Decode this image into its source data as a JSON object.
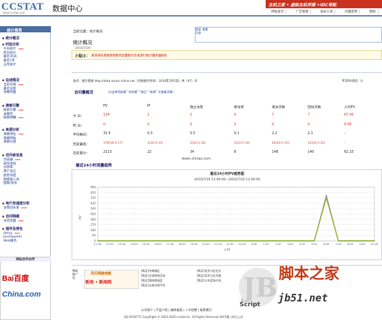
{
  "header": {
    "logo": "CCSTAT",
    "logo_url": "www.ccstat.com",
    "logo_cn": "数据中心",
    "ad_text": "主机之家 • 虚拟主机评测 +IDC导航",
    "links": [
      "网站首页",
      "广告管理",
      "站长工具",
      "问题反馈",
      "帮助"
    ]
  },
  "sidebar": {
    "title": "统计报表",
    "sections": [
      {
        "label": "统计概况",
        "top": 52,
        "items": []
      },
      {
        "label": "时段分析",
        "top": 61,
        "items": [
          {
            "label": "今日统计",
            "new": true
          },
          {
            "label": "昨日统计",
            "new": false
          },
          {
            "label": "最近30天",
            "new": false
          },
          {
            "label": "最近1年",
            "new": false
          },
          {
            "label": "五年统计",
            "new": false
          }
        ]
      },
      {
        "label": "在线情况",
        "top": 113,
        "items": [
          {
            "label": "当前在线",
            "new": true
          },
          {
            "label": "最近访客",
            "new": false
          },
          {
            "label": "详细页面",
            "new": false
          }
        ]
      },
      {
        "label": "搜索引擎",
        "top": 150,
        "items": [
          {
            "label": "搜索引擎",
            "new": true
          },
          {
            "label": "关键字",
            "new": false
          },
          {
            "label": "搜索明细",
            "new": true
          }
        ]
      },
      {
        "label": "来源分析",
        "top": 185,
        "items": [
          {
            "label": "来路地址",
            "new": true
          },
          {
            "label": "来路网站",
            "new": false
          },
          {
            "label": "来路分类",
            "new": false
          }
        ]
      },
      {
        "label": "访问者信息",
        "top": 222,
        "items": [
          {
            "label": "浏览器",
            "new": true
          },
          {
            "label": "操作系统",
            "new": false
          },
          {
            "label": "分辨率",
            "new": false
          },
          {
            "label": "用户语言",
            "new": false
          },
          {
            "label": "颜色深度",
            "new": false
          },
          {
            "label": "网络接入商",
            "new": false
          },
          {
            "label": "国家/省份",
            "new": false
          }
        ]
      },
      {
        "label": "用户忠诚度分析",
        "top": 292,
        "items": [
          {
            "label": "访客回头率",
            "new": true
          }
        ]
      },
      {
        "label": "访问明细",
        "top": 311,
        "items": [
          {
            "label": "访问页面",
            "new": true
          }
        ]
      },
      {
        "label": "插件及排名",
        "top": 329,
        "items": [
          {
            "label": "Alexa",
            "new": true
          },
          {
            "label": "JavaApplets",
            "new": false
          },
          {
            "label": "Web服务",
            "new": false
          }
        ]
      }
    ]
  },
  "friends": {
    "title": "网站合作伙伴",
    "baidu": "Bai百度",
    "china": "China.com"
  },
  "main": {
    "crumb": "当前位置：统计概况",
    "title": "统计概况",
    "date": "（2010/7/20）",
    "login_label": "登录记录",
    "login_link": "查看",
    "tip_label": "小贴士：",
    "tip_text": "即日排名系统改用新的流量统计方式进行统计服务器排名",
    "site_line": "站点：统计系统    http://data.music-china.net（开始统计时间：2010年5月5日）共（97）天",
    "yesterday_pv": "昨日PV排名：0",
    "overview_title": "访问量概况",
    "overview_links": "（点击单项标题 \"浏览量\" \"独立\" \"来源\" 可查看详情）",
    "domain_mark": "down.chinaz.com"
  },
  "table": {
    "headers": [
      "PV",
      "IP",
      "独立访客",
      "新访客",
      "来访次数",
      "回访次数",
      "人均PV"
    ],
    "rows": [
      {
        "label": "今  日：",
        "cells": [
          "134",
          "1",
          "2",
          "0",
          "7",
          "7",
          "67.00"
        ],
        "red": true
      },
      {
        "label": "昨  日：",
        "cells": [
          "0",
          "0",
          "0",
          "0",
          "0",
          "0",
          "0.00"
        ],
        "red": true
      },
      {
        "label": "平均每日：",
        "cells": [
          "31.5",
          "0.3",
          "0.5",
          "0.1",
          "2.2",
          "2.1",
          "-"
        ],
        "red": false
      },
      {
        "label": "历史最高：",
        "cells": [
          "379(10-5-17)",
          "1(10-5-15)",
          "5(10-5-10)",
          "5(10-5-10)",
          "40(10-5-15)",
          "31(10-5-15)",
          "-"
        ],
        "red": false
      },
      {
        "label": "历史累计：",
        "cells": [
          "2113",
          "22",
          "34",
          "8",
          "148",
          "140",
          "62.15"
        ],
        "red": false
      }
    ]
  },
  "chart_section_title": "最近24小时流量趋势",
  "chart_data": {
    "type": "line",
    "title": "最近24小时PV趋势图",
    "subtitle": "2010/7/19 11:00:00—2010/7/20 12:00:00",
    "ylabel": "PV",
    "xlabel": "小时",
    "yticks": [
      "0",
      "90",
      "180",
      "270",
      "360",
      "450",
      "540",
      "630",
      "720",
      "810",
      "900"
    ],
    "ylim": [
      0,
      900
    ],
    "categories": [
      "11:00",
      "12:00",
      "13:00",
      "14:00",
      "15:00",
      "16:00",
      "17:00",
      "18:00",
      "19:00",
      "20:00",
      "21:00",
      "22:00",
      "23:00",
      "0:00",
      "1:00",
      "2:00",
      "3:00",
      "4:00",
      "5:00",
      "6:00",
      "7:00",
      "8:00",
      "9:00",
      "10:00"
    ],
    "series": [
      {
        "name": "",
        "color": "#9b59b6",
        "values": [
          0,
          0,
          0,
          0,
          0,
          0,
          0,
          0,
          0,
          0,
          0,
          0,
          0,
          0,
          0,
          0,
          0,
          0,
          0,
          750,
          0,
          0,
          0,
          0
        ]
      },
      {
        "name": "",
        "color": "#8cbf26",
        "values": [
          0,
          0,
          0,
          0,
          0,
          0,
          0,
          0,
          0,
          0,
          0,
          0,
          0,
          0,
          0,
          0,
          0,
          0,
          0,
          720,
          0,
          0,
          0,
          0
        ]
      }
    ]
  },
  "ads": {
    "label": "赞助商广告",
    "ad1_title": "凤行网络电影",
    "ad1_body": "新闻 • 新闻网",
    "ad2": [
      "[购买]中商城区",
      "[购买]主体招待活动",
      "[购买]国体商园会",
      "[购买]五商乐宿平台"
    ],
    "ad3": [
      "[购买]北京小区社交",
      "[购买]北京小区代理",
      "[购买]火车会场大机"
    ]
  },
  "watermark": {
    "brand": "脚本之家",
    "url": "jb51.net",
    "script": "Script"
  },
  "footer": {
    "links": "公司简介 | 产品介绍 | 媒体报道 | 人才招聘 | 联系我们",
    "copyright": "QQ:9018772 CopyRight © 2003-2010 ccstat.Inc. All Rights Reserved 京ICP备 | 你日上次"
  }
}
